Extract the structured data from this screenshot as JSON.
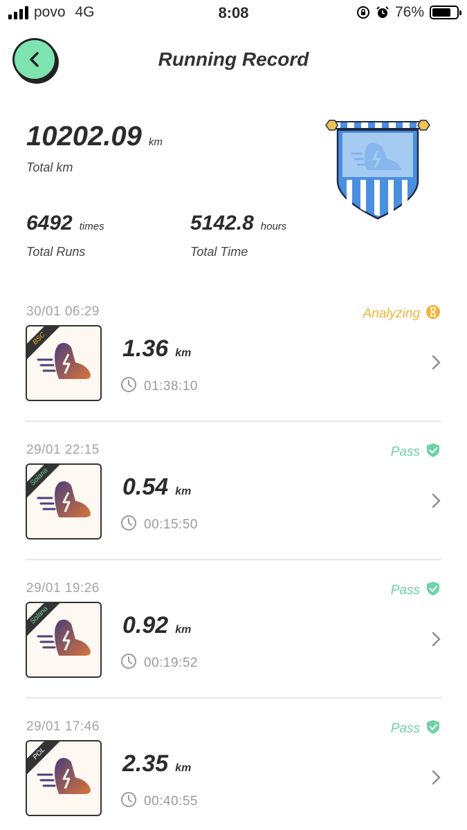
{
  "status_bar": {
    "carrier": "povo",
    "network": "4G",
    "time": "8:08",
    "battery": "76%",
    "battery_level": 0.76
  },
  "header": {
    "title": "Running Record"
  },
  "summary": {
    "total_km_value": "10202.09",
    "total_km_unit": "km",
    "total_km_label": "Total km",
    "runs_value": "6492",
    "runs_unit": "times",
    "runs_label": "Total Runs",
    "time_value": "5142.8",
    "time_unit": "hours",
    "time_label": "Total Time"
  },
  "records": [
    {
      "date": "30/01 06:29",
      "status": "Analyzing",
      "status_type": "analyzing",
      "chain": "BSC",
      "chain_color": "#e8b730",
      "distance": "1.36",
      "unit": "km",
      "duration": "01:38:10"
    },
    {
      "date": "29/01 22:15",
      "status": "Pass",
      "status_type": "pass",
      "chain": "Solana",
      "chain_color": "#6ed3a6",
      "distance": "0.54",
      "unit": "km",
      "duration": "00:15:50"
    },
    {
      "date": "29/01 19:26",
      "status": "Pass",
      "status_type": "pass",
      "chain": "Solana",
      "chain_color": "#6ed3a6",
      "distance": "0.92",
      "unit": "km",
      "duration": "00:19:52"
    },
    {
      "date": "29/01 17:46",
      "status": "Pass",
      "status_type": "pass",
      "chain": "POL",
      "chain_color": "#ffffff",
      "distance": "2.35",
      "unit": "km",
      "duration": "00:40:55"
    }
  ],
  "colors": {
    "accent": "#7fe3b0",
    "pass": "#6ed3a6",
    "analyzing": "#f0b43a",
    "banner_blue": "#4a8fe0"
  }
}
